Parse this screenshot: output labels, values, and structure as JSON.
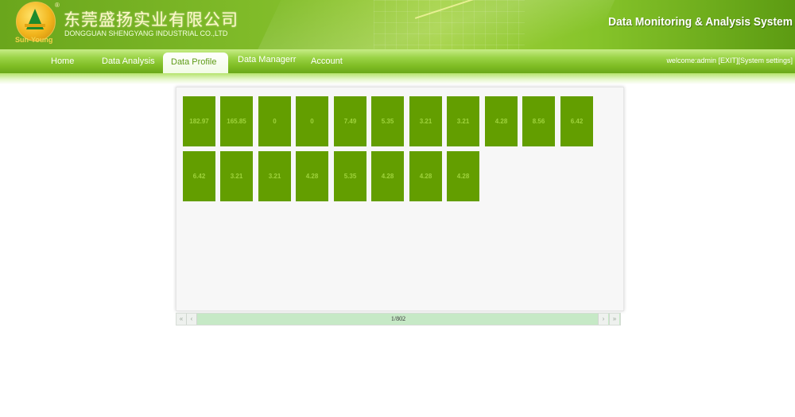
{
  "header": {
    "company_cn": "东莞盛扬实业有限公司",
    "company_en": "DONGGUAN SHENGYANG INDUSTRIAL CO.,LTD",
    "logo_text": "Sun-Young",
    "logo_mark": "®",
    "system_title": "Data Monitoring & Analysis System"
  },
  "nav": {
    "items": [
      "Home",
      "Data Analysis",
      "Data Profile",
      "Data Managerr",
      "Account"
    ],
    "active": "Data Profile",
    "welcome": "welcome:admin [EXIT][System settings]"
  },
  "tiles": [
    "182.97",
    "165.85",
    "0",
    "0",
    "7.49",
    "5.35",
    "3.21",
    "3.21",
    "4.28",
    "8.56",
    "6.42",
    "6.42",
    "3.21",
    "3.21",
    "4.28",
    "5.35",
    "4.28",
    "4.28",
    "4.28"
  ],
  "pager": {
    "text": "1/802",
    "first": "«",
    "prev": "‹",
    "next": "›",
    "last": "»"
  },
  "colors": {
    "tile": "#639e00",
    "tile_text": "#9fd33c",
    "accent": "#5e9b15"
  }
}
